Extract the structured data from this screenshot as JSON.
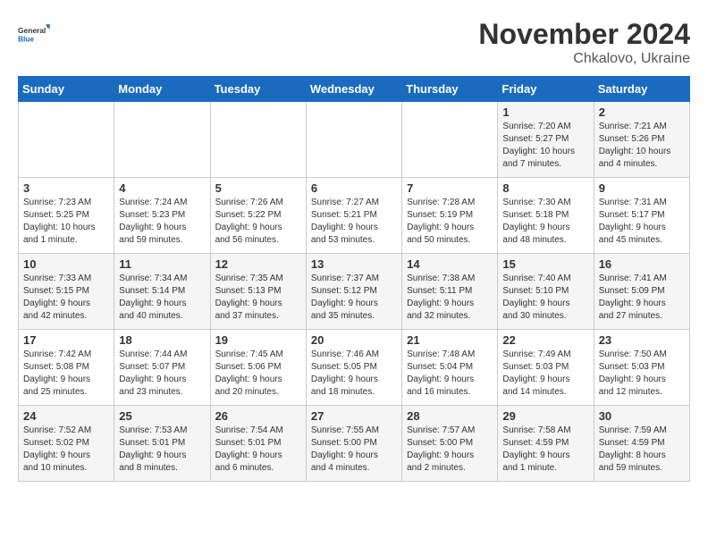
{
  "logo": {
    "line1": "General",
    "line2": "Blue"
  },
  "title": "November 2024",
  "location": "Chkalovo, Ukraine",
  "weekdays": [
    "Sunday",
    "Monday",
    "Tuesday",
    "Wednesday",
    "Thursday",
    "Friday",
    "Saturday"
  ],
  "weeks": [
    [
      {
        "day": "",
        "info": ""
      },
      {
        "day": "",
        "info": ""
      },
      {
        "day": "",
        "info": ""
      },
      {
        "day": "",
        "info": ""
      },
      {
        "day": "",
        "info": ""
      },
      {
        "day": "1",
        "info": "Sunrise: 7:20 AM\nSunset: 5:27 PM\nDaylight: 10 hours\nand 7 minutes."
      },
      {
        "day": "2",
        "info": "Sunrise: 7:21 AM\nSunset: 5:26 PM\nDaylight: 10 hours\nand 4 minutes."
      }
    ],
    [
      {
        "day": "3",
        "info": "Sunrise: 7:23 AM\nSunset: 5:25 PM\nDaylight: 10 hours\nand 1 minute."
      },
      {
        "day": "4",
        "info": "Sunrise: 7:24 AM\nSunset: 5:23 PM\nDaylight: 9 hours\nand 59 minutes."
      },
      {
        "day": "5",
        "info": "Sunrise: 7:26 AM\nSunset: 5:22 PM\nDaylight: 9 hours\nand 56 minutes."
      },
      {
        "day": "6",
        "info": "Sunrise: 7:27 AM\nSunset: 5:21 PM\nDaylight: 9 hours\nand 53 minutes."
      },
      {
        "day": "7",
        "info": "Sunrise: 7:28 AM\nSunset: 5:19 PM\nDaylight: 9 hours\nand 50 minutes."
      },
      {
        "day": "8",
        "info": "Sunrise: 7:30 AM\nSunset: 5:18 PM\nDaylight: 9 hours\nand 48 minutes."
      },
      {
        "day": "9",
        "info": "Sunrise: 7:31 AM\nSunset: 5:17 PM\nDaylight: 9 hours\nand 45 minutes."
      }
    ],
    [
      {
        "day": "10",
        "info": "Sunrise: 7:33 AM\nSunset: 5:15 PM\nDaylight: 9 hours\nand 42 minutes."
      },
      {
        "day": "11",
        "info": "Sunrise: 7:34 AM\nSunset: 5:14 PM\nDaylight: 9 hours\nand 40 minutes."
      },
      {
        "day": "12",
        "info": "Sunrise: 7:35 AM\nSunset: 5:13 PM\nDaylight: 9 hours\nand 37 minutes."
      },
      {
        "day": "13",
        "info": "Sunrise: 7:37 AM\nSunset: 5:12 PM\nDaylight: 9 hours\nand 35 minutes."
      },
      {
        "day": "14",
        "info": "Sunrise: 7:38 AM\nSunset: 5:11 PM\nDaylight: 9 hours\nand 32 minutes."
      },
      {
        "day": "15",
        "info": "Sunrise: 7:40 AM\nSunset: 5:10 PM\nDaylight: 9 hours\nand 30 minutes."
      },
      {
        "day": "16",
        "info": "Sunrise: 7:41 AM\nSunset: 5:09 PM\nDaylight: 9 hours\nand 27 minutes."
      }
    ],
    [
      {
        "day": "17",
        "info": "Sunrise: 7:42 AM\nSunset: 5:08 PM\nDaylight: 9 hours\nand 25 minutes."
      },
      {
        "day": "18",
        "info": "Sunrise: 7:44 AM\nSunset: 5:07 PM\nDaylight: 9 hours\nand 23 minutes."
      },
      {
        "day": "19",
        "info": "Sunrise: 7:45 AM\nSunset: 5:06 PM\nDaylight: 9 hours\nand 20 minutes."
      },
      {
        "day": "20",
        "info": "Sunrise: 7:46 AM\nSunset: 5:05 PM\nDaylight: 9 hours\nand 18 minutes."
      },
      {
        "day": "21",
        "info": "Sunrise: 7:48 AM\nSunset: 5:04 PM\nDaylight: 9 hours\nand 16 minutes."
      },
      {
        "day": "22",
        "info": "Sunrise: 7:49 AM\nSunset: 5:03 PM\nDaylight: 9 hours\nand 14 minutes."
      },
      {
        "day": "23",
        "info": "Sunrise: 7:50 AM\nSunset: 5:03 PM\nDaylight: 9 hours\nand 12 minutes."
      }
    ],
    [
      {
        "day": "24",
        "info": "Sunrise: 7:52 AM\nSunset: 5:02 PM\nDaylight: 9 hours\nand 10 minutes."
      },
      {
        "day": "25",
        "info": "Sunrise: 7:53 AM\nSunset: 5:01 PM\nDaylight: 9 hours\nand 8 minutes."
      },
      {
        "day": "26",
        "info": "Sunrise: 7:54 AM\nSunset: 5:01 PM\nDaylight: 9 hours\nand 6 minutes."
      },
      {
        "day": "27",
        "info": "Sunrise: 7:55 AM\nSunset: 5:00 PM\nDaylight: 9 hours\nand 4 minutes."
      },
      {
        "day": "28",
        "info": "Sunrise: 7:57 AM\nSunset: 5:00 PM\nDaylight: 9 hours\nand 2 minutes."
      },
      {
        "day": "29",
        "info": "Sunrise: 7:58 AM\nSunset: 4:59 PM\nDaylight: 9 hours\nand 1 minute."
      },
      {
        "day": "30",
        "info": "Sunrise: 7:59 AM\nSunset: 4:59 PM\nDaylight: 8 hours\nand 59 minutes."
      }
    ]
  ]
}
